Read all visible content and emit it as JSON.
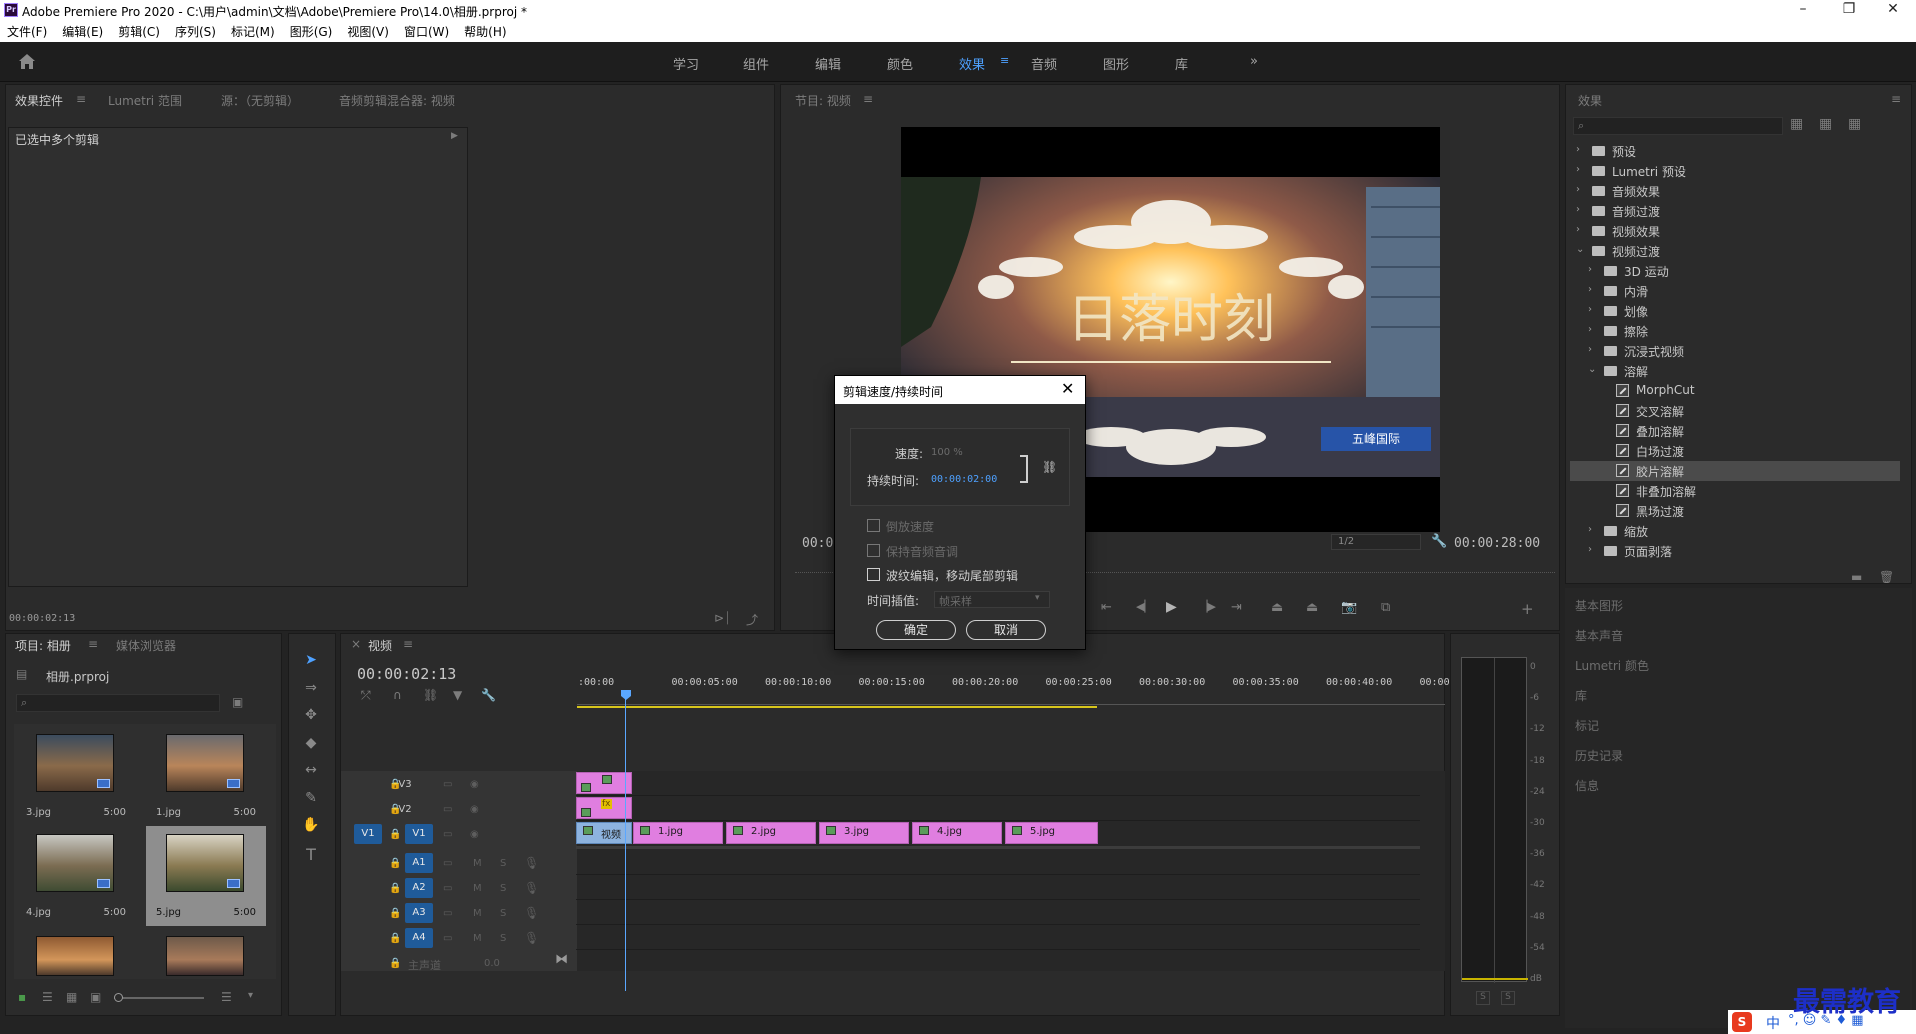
{
  "window": {
    "title": "Adobe Premiere Pro 2020 - C:\\用户\\admin\\文档\\Adobe\\Premiere Pro\\14.0\\相册.prproj *",
    "logo": "Pr",
    "min": "–",
    "max": "❐",
    "close": "✕"
  },
  "menu": [
    "文件(F)",
    "编辑(E)",
    "剪辑(C)",
    "序列(S)",
    "标记(M)",
    "图形(G)",
    "视图(V)",
    "窗口(W)",
    "帮助(H)"
  ],
  "workspaces": {
    "items": [
      "学习",
      "组件",
      "编辑",
      "颜色",
      "效果",
      "音频",
      "图形",
      "库"
    ],
    "active": "效果",
    "more": "»"
  },
  "effect_controls": {
    "tabs": [
      "效果控件",
      "Lumetri 范围",
      "源：（无剪辑）",
      "音频剪辑混合器: 视频"
    ],
    "header": "已选中多个剪辑",
    "timecode": "00:00:02:13"
  },
  "program": {
    "title": "节目: 视频",
    "video_title_text": "日落时刻",
    "timecode_left": "00:0",
    "timecode_right": "00:00:28:00",
    "zoom": "1/2",
    "sign_text": "五峰国际"
  },
  "effects_panel": {
    "title": "效果",
    "items": [
      {
        "label": "预设",
        "level": 0,
        "type": "folder",
        "expanded": false
      },
      {
        "label": "Lumetri 预设",
        "level": 0,
        "type": "folder",
        "expanded": false
      },
      {
        "label": "音频效果",
        "level": 0,
        "type": "folder",
        "expanded": false
      },
      {
        "label": "音频过渡",
        "level": 0,
        "type": "folder",
        "expanded": false
      },
      {
        "label": "视频效果",
        "level": 0,
        "type": "folder",
        "expanded": false
      },
      {
        "label": "视频过渡",
        "level": 0,
        "type": "folder",
        "expanded": true
      },
      {
        "label": "3D 运动",
        "level": 1,
        "type": "folder",
        "expanded": false
      },
      {
        "label": "内滑",
        "level": 1,
        "type": "folder",
        "expanded": false
      },
      {
        "label": "划像",
        "level": 1,
        "type": "folder",
        "expanded": false
      },
      {
        "label": "擦除",
        "level": 1,
        "type": "folder",
        "expanded": false
      },
      {
        "label": "沉浸式视频",
        "level": 1,
        "type": "folder",
        "expanded": false
      },
      {
        "label": "溶解",
        "level": 1,
        "type": "folder",
        "expanded": true
      },
      {
        "label": "MorphCut",
        "level": 2,
        "type": "effect"
      },
      {
        "label": "交叉溶解",
        "level": 2,
        "type": "effect"
      },
      {
        "label": "叠加溶解",
        "level": 2,
        "type": "effect"
      },
      {
        "label": "白场过渡",
        "level": 2,
        "type": "effect"
      },
      {
        "label": "胶片溶解",
        "level": 2,
        "type": "effect",
        "selected": true
      },
      {
        "label": "非叠加溶解",
        "level": 2,
        "type": "effect"
      },
      {
        "label": "黑场过渡",
        "level": 2,
        "type": "effect"
      },
      {
        "label": "缩放",
        "level": 1,
        "type": "folder",
        "expanded": false
      },
      {
        "label": "页面剥落",
        "level": 1,
        "type": "folder",
        "expanded": false
      }
    ],
    "side_panels": [
      "基本图形",
      "基本声音",
      "Lumetri 颜色",
      "库",
      "标记",
      "历史记录",
      "信息"
    ]
  },
  "project": {
    "tabs": [
      "项目: 相册",
      "媒体浏览器"
    ],
    "file": "相册.prproj",
    "items": [
      {
        "name": "3.jpg",
        "dur": "5:00"
      },
      {
        "name": "1.jpg",
        "dur": "5:00"
      },
      {
        "name": "4.jpg",
        "dur": "5:00"
      },
      {
        "name": "5.jpg",
        "dur": "5:00"
      }
    ]
  },
  "timeline": {
    "title": "视频",
    "timecode": "00:00:02:13",
    "ruler": [
      ":00:00",
      "00:00:05:00",
      "00:00:10:00",
      "00:00:15:00",
      "00:00:20:00",
      "00:00:25:00",
      "00:00:30:00",
      "00:00:35:00",
      "00:00:40:00",
      "00:00:"
    ],
    "video_tracks": [
      "V3",
      "V2",
      "V1"
    ],
    "audio_tracks": [
      "A1",
      "A2",
      "A3",
      "A4"
    ],
    "source_patch": "V1",
    "master": "主声道",
    "master_val": "0.0",
    "clips": [
      "视频",
      "1.jpg",
      "2.jpg",
      "3.jpg",
      "4.jpg",
      "5.jpg"
    ],
    "fx": "fx",
    "m": "M",
    "s": "S"
  },
  "meter": {
    "labels": [
      "0",
      "-6",
      "-12",
      "-18",
      "-24",
      "-30",
      "-36",
      "-42",
      "-48",
      "-54",
      "dB"
    ],
    "s": "S"
  },
  "dialog": {
    "title": "剪辑速度/持续时间",
    "speed_label": "速度:",
    "speed_value": "100 %",
    "duration_label": "持续时间:",
    "duration_value": "00:00:02:00",
    "reverse": "倒放速度",
    "maintain_pitch": "保持音频音调",
    "ripple": "波纹编辑，移动尾部剪辑",
    "interp_label": "时间插值:",
    "interp_value": "帧采样",
    "ok": "确定",
    "cancel": "取消"
  },
  "watermark": {
    "text": "最需教育",
    "ime": "中"
  }
}
